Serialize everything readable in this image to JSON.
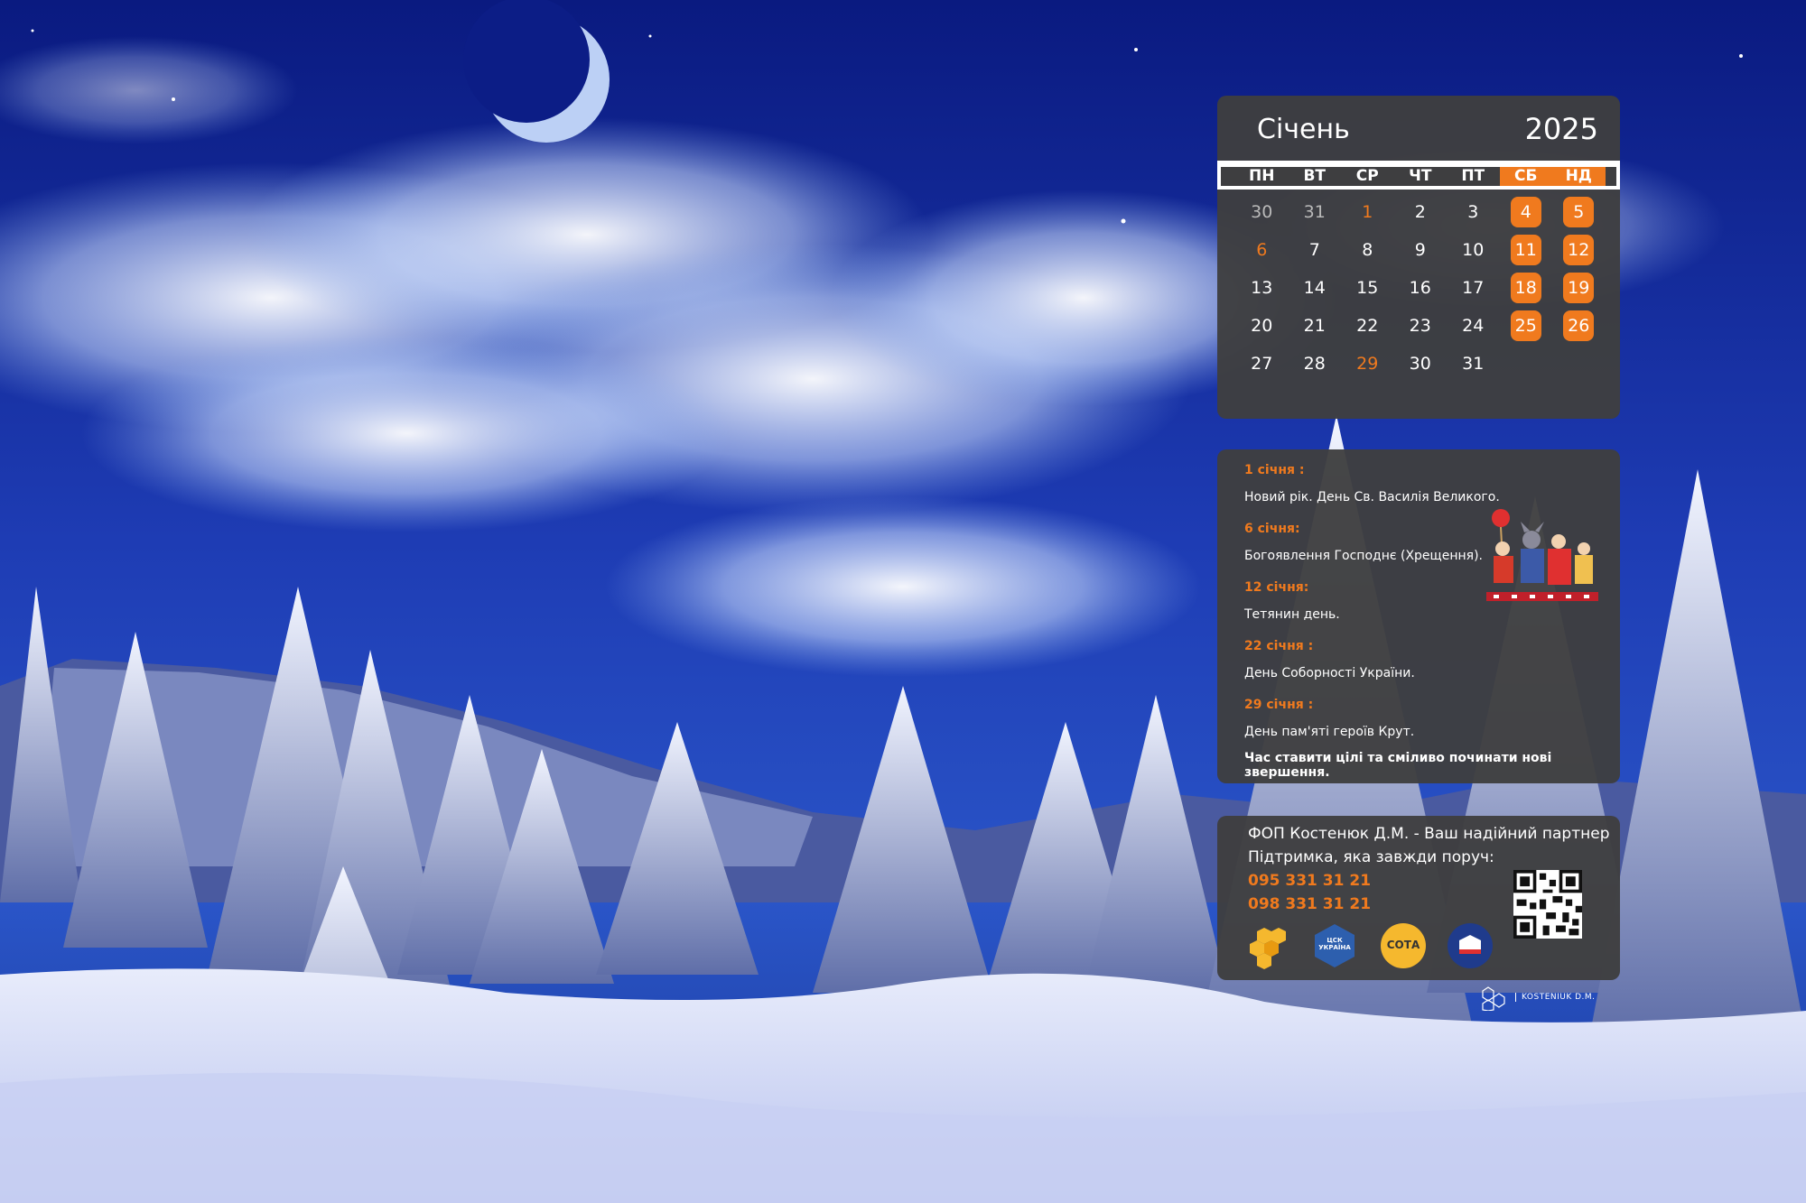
{
  "calendar": {
    "month": "Січень",
    "year": "2025",
    "weekdays": [
      "ПН",
      "ВТ",
      "СР",
      "ЧТ",
      "ПТ",
      "СБ",
      "НД"
    ],
    "weeks": [
      [
        "30",
        "31",
        "1",
        "2",
        "3",
        "4",
        "5"
      ],
      [
        "6",
        "7",
        "8",
        "9",
        "10",
        "11",
        "12"
      ],
      [
        "13",
        "14",
        "15",
        "16",
        "17",
        "18",
        "19"
      ],
      [
        "20",
        "21",
        "22",
        "23",
        "24",
        "25",
        "26"
      ],
      [
        "27",
        "28",
        "29",
        "30",
        "31",
        "",
        ""
      ]
    ],
    "accent_color": "#f07a1e",
    "panel_color": "#3e3e40"
  },
  "holidays": {
    "items": [
      {
        "date": "1 січня :",
        "text": "Новий рік.  День Св. Василія Великого."
      },
      {
        "date": "6 січня:",
        "text": "Богоявлення Господнє (Хрещення)."
      },
      {
        "date": "12 січня:",
        "text": "Тетянин день."
      },
      {
        "date": "22 січня :",
        "text": "День Соборності України."
      },
      {
        "date": "29 січня :",
        "text": "День пам'яті героїв Крут."
      }
    ],
    "motto": "Час ставити цілі та сміливо починати нові звершення."
  },
  "contact": {
    "line1": "ФОП Костенюк Д.М. - Ваш надійний партнер",
    "line2": "Підтримка, яка завжди поруч:",
    "phone1": "095 331 31 21",
    "phone2": "098 331 31 21",
    "logo_labels": {
      "csk": "ЦСК УКРАЇНА",
      "sota": "СОТА"
    },
    "brand": "KOSTENIUK D.M."
  },
  "icons": [
    "moon-icon",
    "qr-code-icon",
    "honeycomb-logo-icon",
    "csk-logo-icon",
    "sota-logo-icon",
    "medoc-logo-icon",
    "brand-logo-icon"
  ]
}
